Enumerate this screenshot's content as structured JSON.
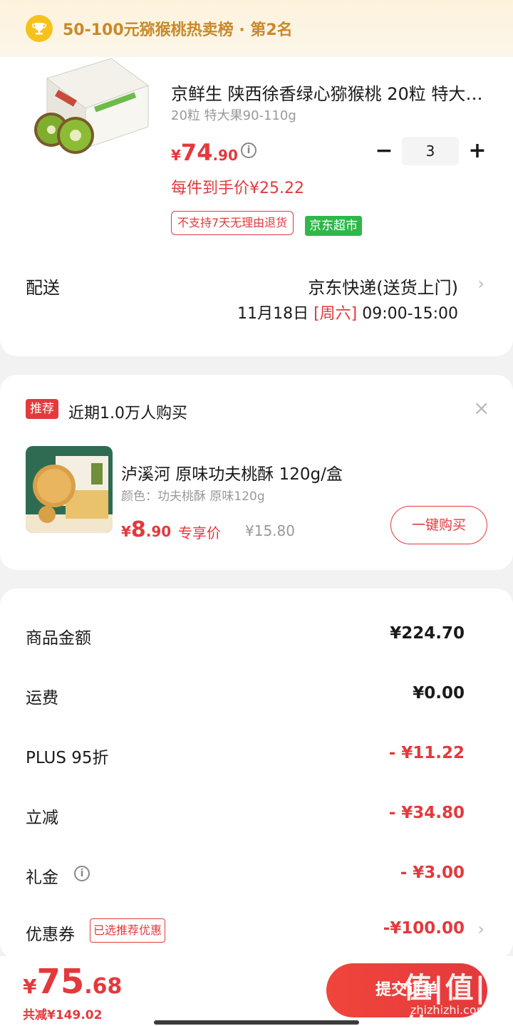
{
  "banner": {
    "text": "50-100元猕猴桃热卖榜 · 第2名",
    "icon": "trophy-icon"
  },
  "product": {
    "title": "京鲜生 陕西徐香绿心猕猴桃 20粒 特大果90-110g",
    "spec": "20粒 特大果90-110g",
    "price_yen": "¥",
    "price_int": "74",
    "price_dec": ".90",
    "unit_price": "每件到手价¥25.22",
    "quantity": "3",
    "tag_noreturn": "不支持7天无理由退货",
    "tag_market": "京东超市"
  },
  "shipping": {
    "label": "配送",
    "method": "京东快递(送货上门)",
    "date": "11月18日 ",
    "weekday": "[周六]",
    "time": " 09:00-15:00"
  },
  "recommend": {
    "badge": "推荐",
    "title": "近期1.0万人购买",
    "name": "泸溪河 原味功夫桃酥 120g/盒",
    "spec": "颜色：功夫桃酥 原味120g",
    "price_yen": "¥",
    "price_int": "8",
    "price_dec": ".90",
    "exclusive": "专享价",
    "orig_price": "¥15.80",
    "buy_label": "一键购买"
  },
  "summary": [
    {
      "label": "商品金额",
      "value": "¥224.70"
    },
    {
      "label": "运费",
      "value": "¥0.00"
    },
    {
      "label": "PLUS 95折",
      "value": "- ¥11.22"
    },
    {
      "label": "立减",
      "value": "- ¥34.80"
    },
    {
      "label": "礼金",
      "value": "- ¥3.00"
    },
    {
      "label": "优惠券",
      "value": "-¥100.00",
      "tag": "已选推荐优惠"
    }
  ],
  "footer": {
    "total_yen": "¥",
    "total_int": "75",
    "total_dec": ".68",
    "saved": "共减¥149.02",
    "submit_label": "提交订单",
    "watermark": "值|值|值",
    "watermark_site": "zhizhizhi.com"
  },
  "colors": {
    "accent": "#e4393c",
    "market": "#2fb84a",
    "banner_text": "#c9892a"
  }
}
